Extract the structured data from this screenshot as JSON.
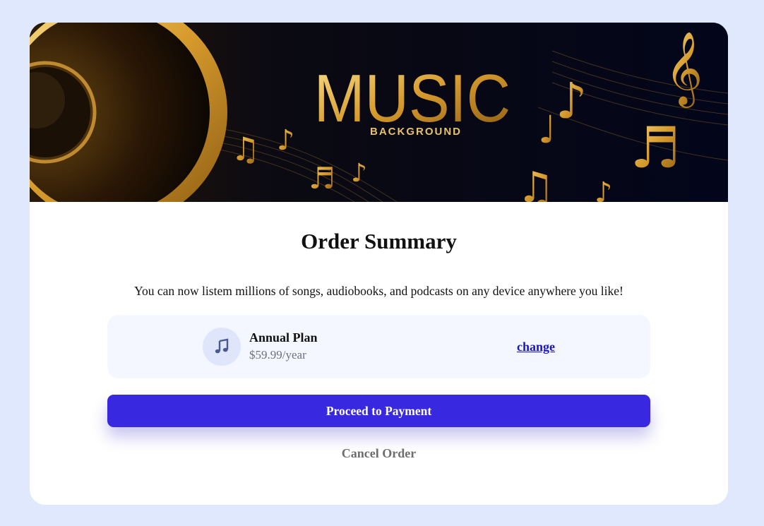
{
  "hero": {
    "headline": "MUSIC",
    "tagline": "BACKGROUND"
  },
  "summary": {
    "title": "Order Summary",
    "subtitle": "You can now listem millions of songs, audiobooks, and podcasts on any device anywhere you like!"
  },
  "plan": {
    "icon": "music-note-icon",
    "name": "Annual Plan",
    "price": "$59.99/year",
    "change_label": "change"
  },
  "actions": {
    "proceed_label": "Proceed to Payment",
    "cancel_label": "Cancel Order"
  },
  "colors": {
    "page_background": "#e0e8fd",
    "accent": "#3829e0",
    "plan_card": "#f4f7ff",
    "link": "#1a14c9",
    "gold": "#d9a441"
  }
}
